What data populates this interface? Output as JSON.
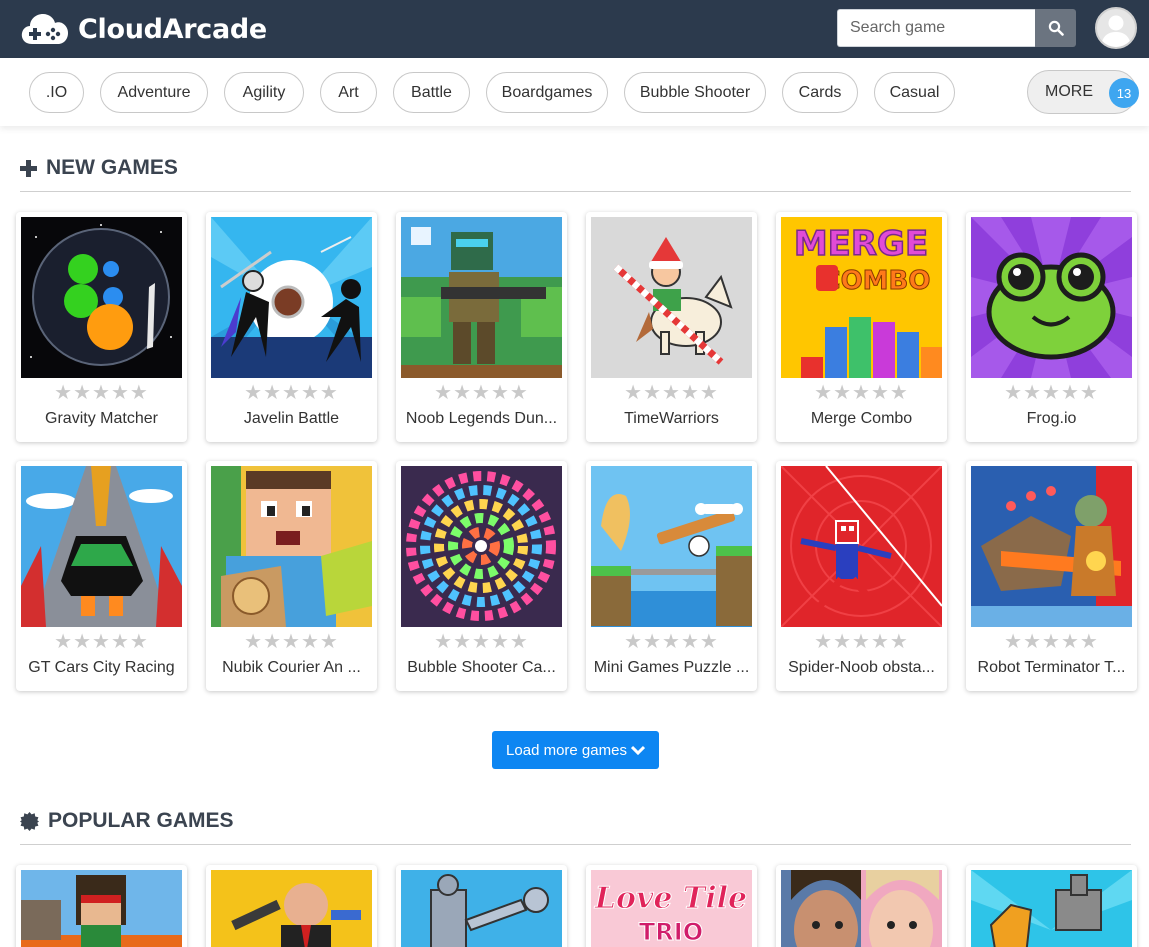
{
  "header": {
    "brand": "CloudArcade",
    "search_placeholder": "Search game",
    "brand_color": "#2c3a4d"
  },
  "categories": {
    "items": [
      ".IO",
      "Adventure",
      "Agility",
      "Art",
      "Battle",
      "Boardgames",
      "Bubble Shooter",
      "Cards",
      "Casual"
    ],
    "more_label": "MORE",
    "more_count": "13"
  },
  "new_games": {
    "title": "NEW GAMES",
    "items": [
      {
        "title": "Gravity Matcher",
        "rating": 0
      },
      {
        "title": "Javelin Battle",
        "rating": 0
      },
      {
        "title": "Noob Legends Dun...",
        "rating": 0
      },
      {
        "title": "TimeWarriors",
        "rating": 0
      },
      {
        "title": "Merge Combo",
        "rating": 0
      },
      {
        "title": "Frog.io",
        "rating": 0
      },
      {
        "title": "GT Cars City Racing",
        "rating": 0
      },
      {
        "title": "Nubik Courier An ...",
        "rating": 0
      },
      {
        "title": "Bubble Shooter Ca...",
        "rating": 0
      },
      {
        "title": "Mini Games Puzzle ...",
        "rating": 0
      },
      {
        "title": "Spider-Noob obsta...",
        "rating": 0
      },
      {
        "title": "Robot Terminator T...",
        "rating": 0
      }
    ],
    "load_more": "Load more games"
  },
  "popular_games": {
    "title": "POPULAR GAMES"
  },
  "icons": {
    "logo": "gamepad-cloud-icon",
    "search": "search-icon",
    "new": "plus-icon",
    "popular": "badge-icon",
    "load_more": "chevron-down-icon"
  }
}
